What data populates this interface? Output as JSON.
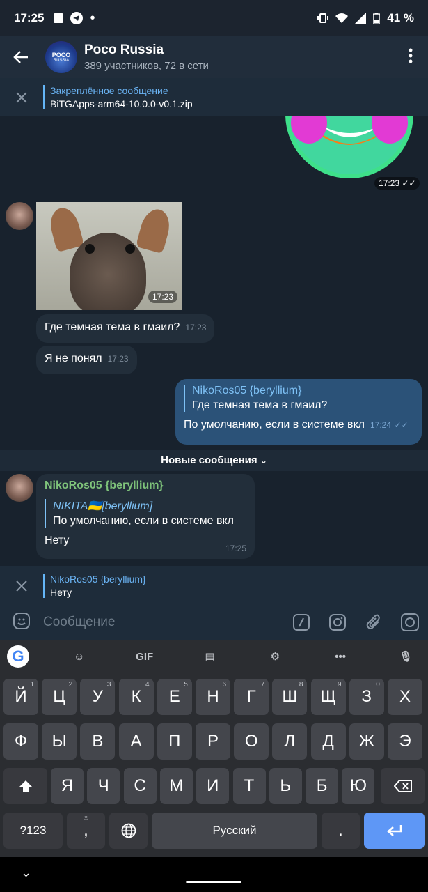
{
  "status": {
    "time": "17:25",
    "battery": "41 %"
  },
  "header": {
    "title": "Poco Russia",
    "subtitle": "389 участников, 72 в сети",
    "avatar_text": "POCO",
    "avatar_sub": "RUSSIA"
  },
  "pinned": {
    "label": "Закреплённое сообщение",
    "text": "BiTGApps-arm64-10.0.0-v0.1.zip"
  },
  "messages": {
    "sticker_time": "17:23",
    "photo_time": "17:23",
    "m1": {
      "text": "Где темная тема в гмаил?",
      "time": "17:23"
    },
    "m2": {
      "text": "Я не понял",
      "time": "17:23"
    },
    "m3": {
      "reply_name": "NikoRos05 {beryllium}",
      "reply_text": "Где темная тема в гмаил?",
      "text": "По умолчанию, если в системе вкл",
      "time": "17:24"
    },
    "new_messages": "Новые сообщения",
    "m4": {
      "sender": "NikoRos05 {beryllium}",
      "reply_name": "NIKITA🇺🇦[beryllium]",
      "reply_text": "По умолчанию, если в системе вкл",
      "text": "Нету",
      "time": "17:25"
    }
  },
  "reply_bar": {
    "name": "NikoRos05 {beryllium}",
    "text": "Нету"
  },
  "composer": {
    "placeholder": "Сообщение"
  },
  "keyboard": {
    "row1": [
      [
        "Й",
        "1"
      ],
      [
        "Ц",
        "2"
      ],
      [
        "У",
        "3"
      ],
      [
        "К",
        "4"
      ],
      [
        "Е",
        "5"
      ],
      [
        "Н",
        "6"
      ],
      [
        "Г",
        "7"
      ],
      [
        "Ш",
        "8"
      ],
      [
        "Щ",
        "9"
      ],
      [
        "З",
        "0"
      ],
      [
        "Х",
        ""
      ]
    ],
    "row2": [
      "Ф",
      "Ы",
      "В",
      "А",
      "П",
      "Р",
      "О",
      "Л",
      "Д",
      "Ж",
      "Э"
    ],
    "row3": [
      "Я",
      "Ч",
      "С",
      "М",
      "И",
      "Т",
      "Ь",
      "Б",
      "Ю"
    ],
    "sym": "?123",
    "space": "Русский",
    "comma": ",",
    "period": ".",
    "gif": "GIF"
  },
  "colors": {
    "accent": "#6ab3f3",
    "sender_green": "#7ec27a",
    "out_bubble": "#2b5278",
    "in_bubble": "#222e3a"
  }
}
